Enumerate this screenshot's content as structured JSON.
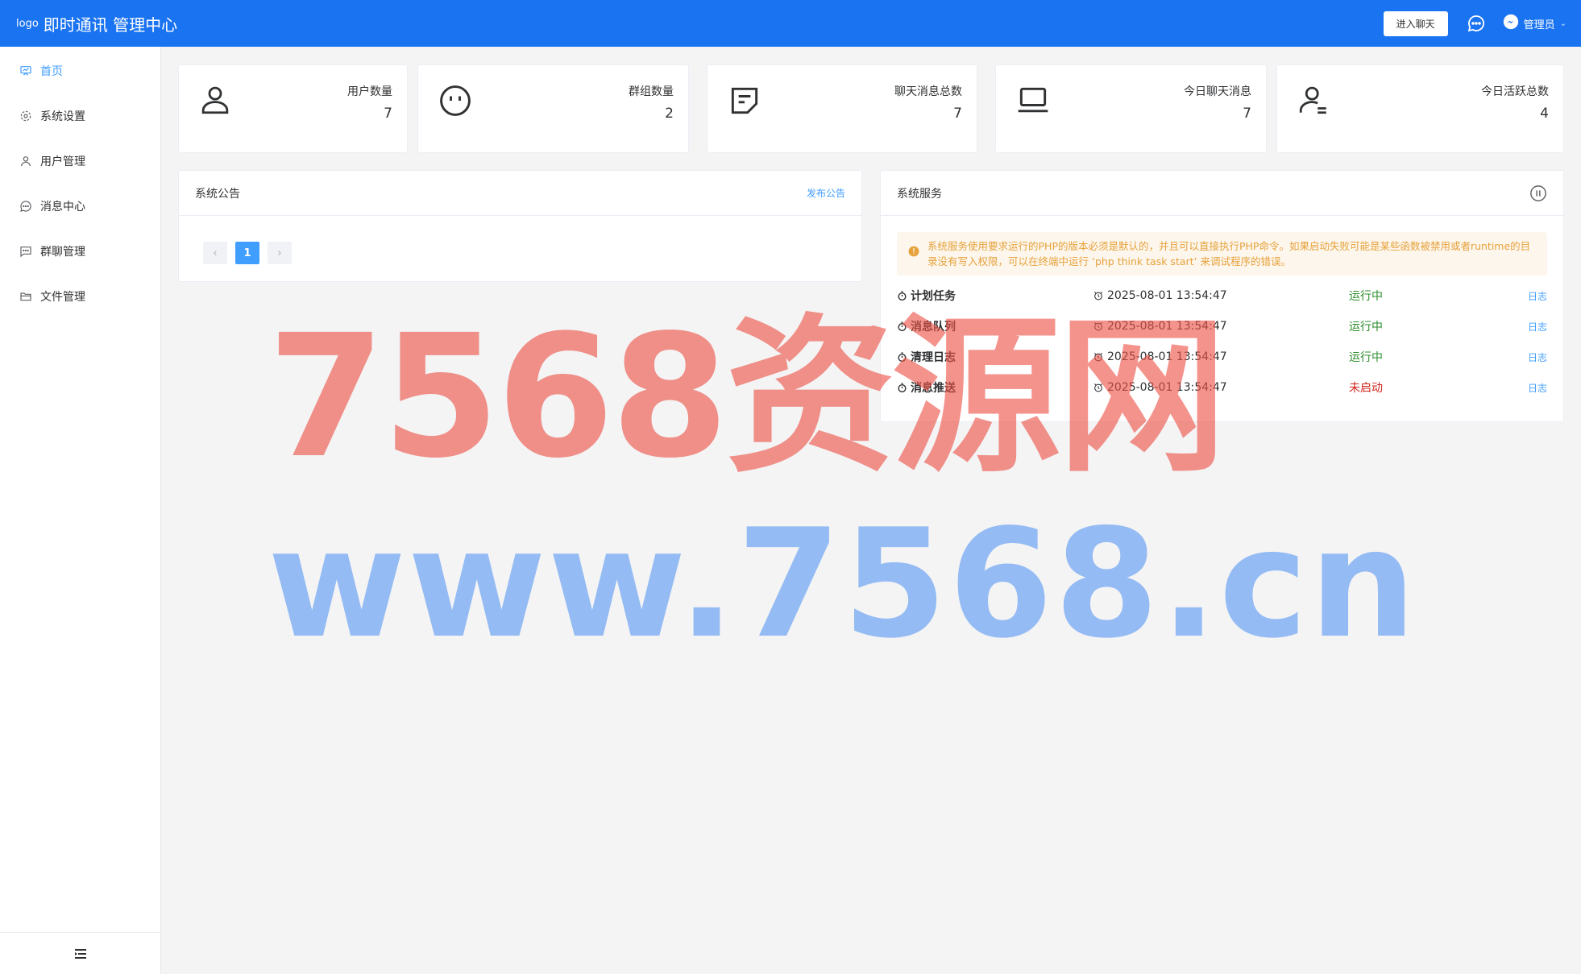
{
  "header": {
    "logo_alt": "logo",
    "title": "即时通讯 管理中心",
    "enter_chat": "进入聊天",
    "user_name": "管理员",
    "caret": "⌄"
  },
  "sidebar": {
    "items": [
      {
        "label": "首页",
        "icon": "home-board-icon",
        "active": true
      },
      {
        "label": "系统设置",
        "icon": "gear-icon"
      },
      {
        "label": "用户管理",
        "icon": "user-icon"
      },
      {
        "label": "消息中心",
        "icon": "chat-bubble-icon"
      },
      {
        "label": "群聊管理",
        "icon": "chat-square-icon"
      },
      {
        "label": "文件管理",
        "icon": "folder-icon"
      }
    ],
    "collapse_icon": "collapse-menu-icon"
  },
  "stats": [
    {
      "label": "用户数量",
      "value": "7",
      "icon": "user-icon"
    },
    {
      "label": "群组数量",
      "value": "2",
      "icon": "face-icon"
    },
    {
      "label": "聊天消息总数",
      "value": "7",
      "icon": "message-square-icon"
    },
    {
      "label": "今日聊天消息",
      "value": "7",
      "icon": "laptop-icon"
    },
    {
      "label": "今日活跃总数",
      "value": "4",
      "icon": "user-check-icon"
    }
  ],
  "notice": {
    "title": "系统公告",
    "publish": "发布公告",
    "prev": "‹",
    "page": "1",
    "next": "›"
  },
  "service": {
    "title": "系统服务",
    "alert": "系统服务使用要求运行的PHP的版本必须是默认的，并且可以直接执行PHP命令。如果启动失败可能是某些函数被禁用或者runtime的目录没有写入权限，可以在终端中运行 ‘php think task start’ 来调试程序的错误。",
    "rows": [
      {
        "name": "计划任务",
        "time": "2025-08-01 13:54:47",
        "status": "运行中",
        "ok": true,
        "log": "日志"
      },
      {
        "name": "消息队列",
        "time": "2025-08-01 13:54:47",
        "status": "运行中",
        "ok": true,
        "log": "日志"
      },
      {
        "name": "清理日志",
        "time": "2025-08-01 13:54:47",
        "status": "运行中",
        "ok": true,
        "log": "日志"
      },
      {
        "name": "消息推送",
        "time": "2025-08-01 13:54:47",
        "status": "未启动",
        "ok": false,
        "log": "日志"
      }
    ]
  },
  "watermark": {
    "line1": "7568资源网",
    "line2": "www.7568.cn"
  },
  "colors": {
    "header": "#1a73f0",
    "accent": "#409eff",
    "running": "#2c8c2c",
    "stopped": "#d0251c",
    "warning": "#e6a23c"
  }
}
